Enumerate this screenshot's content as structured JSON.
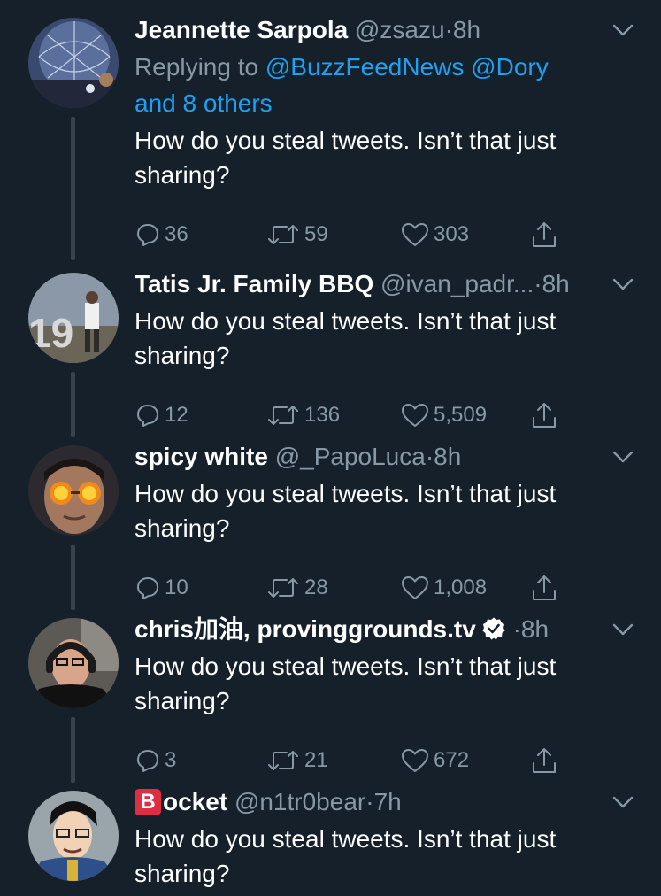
{
  "tweets": [
    {
      "name": "Jeannette Sarpola",
      "handle": "@zsazu",
      "dot": "·",
      "time": "8h",
      "reply_prefix": "Replying to ",
      "reply_links": [
        "@BuzzFeedNews",
        "@Dory",
        "and 8 others"
      ],
      "text": "How do you steal tweets. Isn’t that just sharing?",
      "replies": "36",
      "retweets": "59",
      "likes": "303"
    },
    {
      "name": "Tatis Jr. Family BBQ",
      "handle": "@ivan_padr...",
      "dot": "·",
      "time": "8h",
      "text": "How do you steal tweets. Isn’t that just sharing?",
      "replies": "12",
      "retweets": "136",
      "likes": "5,509"
    },
    {
      "name": "spicy white",
      "handle": "@_PapoLuca",
      "dot": "·",
      "time": "8h",
      "text": "How do you steal tweets. Isn’t that just sharing?",
      "replies": "10",
      "retweets": "28",
      "likes": "1,008"
    },
    {
      "name": "chris加油, provinggrounds.tv",
      "handle": "",
      "dot": "·",
      "time": "8h",
      "verified": true,
      "text": "How do you steal tweets. Isn’t that just sharing?",
      "replies": "3",
      "retweets": "21",
      "likes": "672"
    },
    {
      "name_badge": "B",
      "name": "ocket",
      "handle": "@n1tr0bear",
      "dot": "·",
      "time": "7h",
      "text": "How do you steal tweets. Isn’t that just sharing?"
    }
  ],
  "icons": {
    "caret": "chevron-down-icon",
    "reply": "reply-icon",
    "retweet": "retweet-icon",
    "like": "heart-icon",
    "share": "share-icon",
    "verified": "verified-badge-icon"
  },
  "colors": {
    "background": "#15202b",
    "secondary_text": "#8899a6",
    "link": "#1da1f2",
    "thread_line": "#38444d"
  }
}
